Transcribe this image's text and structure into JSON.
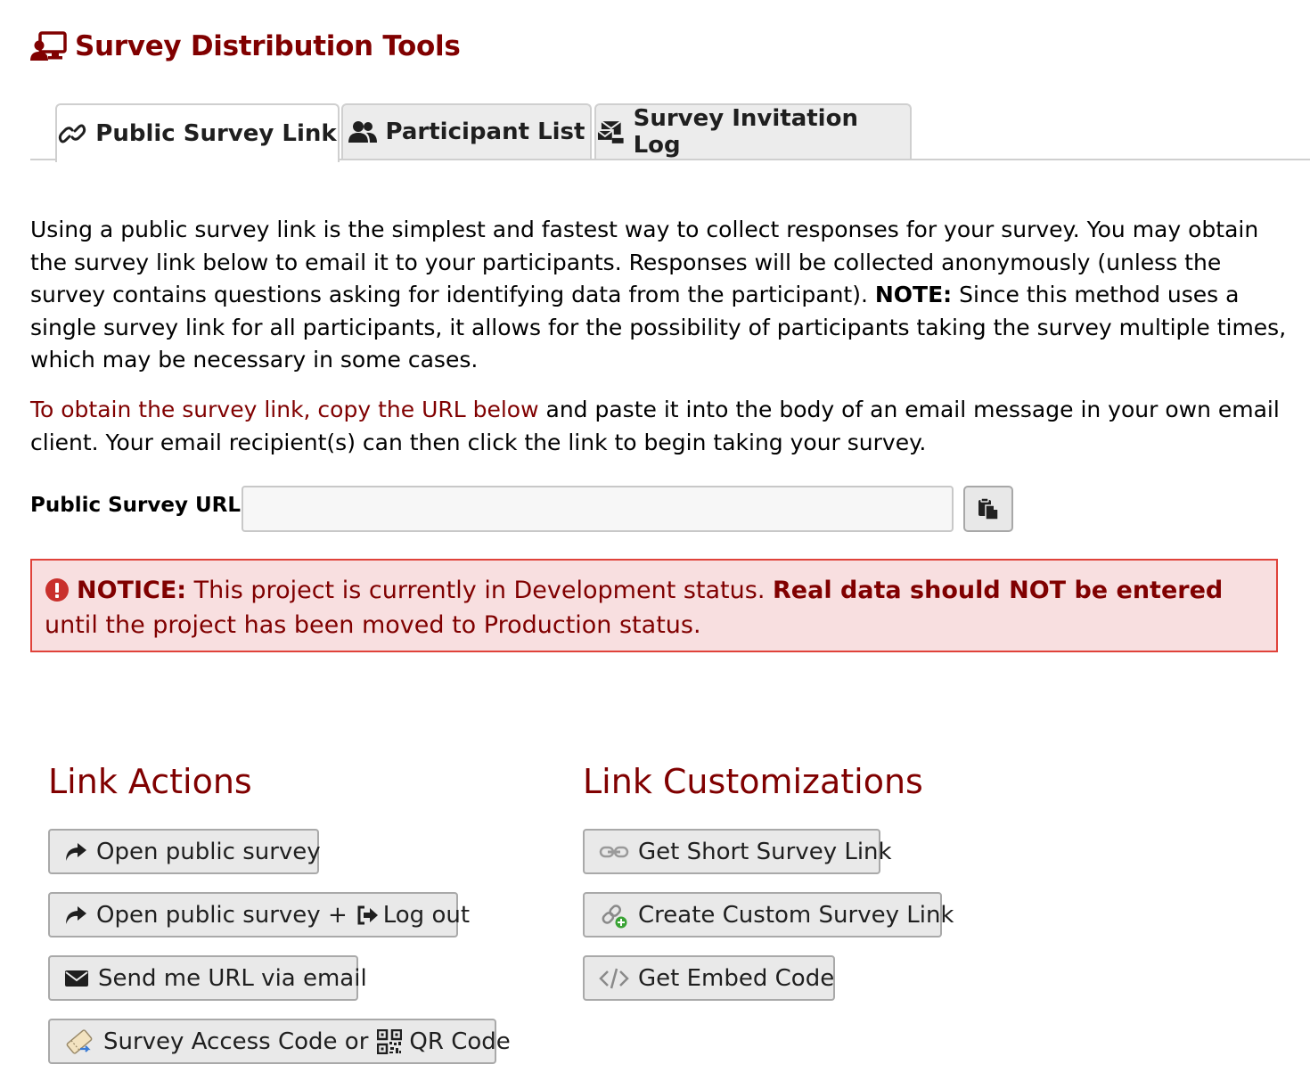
{
  "header": {
    "title": "Survey Distribution Tools",
    "icon": "distribution-icon"
  },
  "tabs": [
    {
      "label": "Public Survey Link",
      "icon": "link-icon",
      "active": true
    },
    {
      "label": "Participant List",
      "icon": "users-icon",
      "active": false
    },
    {
      "label": "Survey Invitation Log",
      "icon": "mail-log-icon",
      "active": false
    }
  ],
  "intro": {
    "text_1": "Using a public survey link is the simplest and fastest way to collect responses for your survey. You may obtain the survey link below to email it to your participants. Responses will be collected anonymously (unless the survey contains questions asking for identifying data from the participant). ",
    "note_label": "NOTE:",
    "text_2": " Since this method uses a single survey link for all participants, it allows for the possibility of participants taking the survey multiple times, which may be necessary in some cases."
  },
  "instructions": {
    "highlight": "To obtain the survey link, copy the URL below",
    "rest": " and paste it into the body of an email message in your own email client. Your email recipient(s) can then click the link to begin taking your survey."
  },
  "url_field": {
    "label": "Public Survey URL:",
    "value": ""
  },
  "notice": {
    "label": "NOTICE:",
    "text_1": " This project is currently in Development status. ",
    "bold": "Real data should NOT be entered",
    "text_2": " until the project has been moved to Production status."
  },
  "link_actions": {
    "title": "Link Actions",
    "open_survey": "Open public survey",
    "open_survey_logout": "Open public survey +",
    "logout": "Log out",
    "send_email": "Send me URL via email",
    "access_code": "Survey Access Code or",
    "qr_code": "QR Code"
  },
  "link_customizations": {
    "title": "Link Customizations",
    "short_link": "Get Short Survey Link",
    "custom_link": "Create Custom Survey Link",
    "embed_code": "Get Embed Code"
  },
  "colors": {
    "brand": "#800000",
    "notice_bg": "#f8dfe0",
    "notice_border": "#e0423a"
  }
}
